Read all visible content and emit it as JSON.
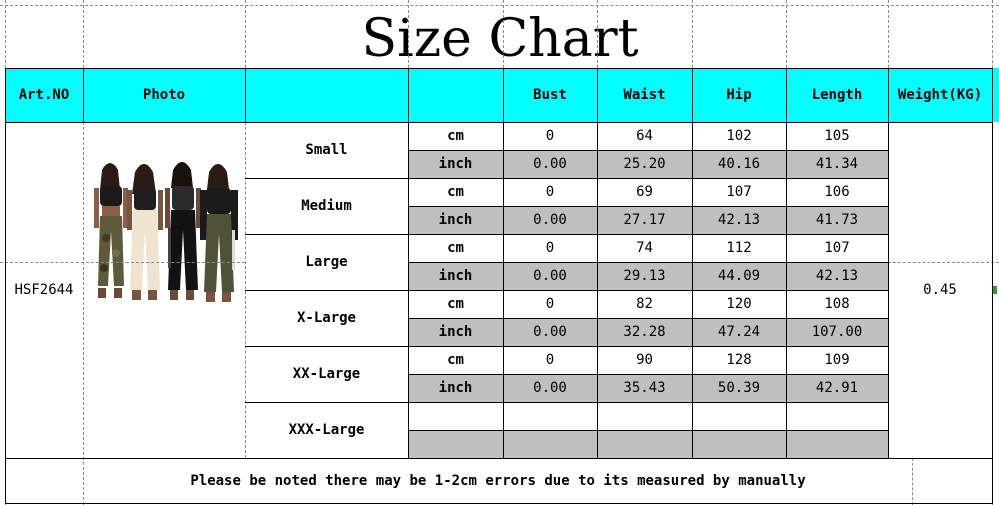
{
  "title": "Size Chart",
  "header": {
    "art_no": "Art.NO",
    "photo": "Photo",
    "bust": "Bust",
    "waist": "Waist",
    "hip": "Hip",
    "length": "Length",
    "weight": "Weight(KG)"
  },
  "art_no_value": "HSF2644",
  "weight_value": "0.45",
  "sizes": [
    {
      "name": "Small",
      "cm": {
        "unit": "cm",
        "bust": "0",
        "waist": "64",
        "hip": "102",
        "length": "105"
      },
      "inch": {
        "unit": "inch",
        "bust": "0.00",
        "waist": "25.20",
        "hip": "40.16",
        "length": "41.34"
      }
    },
    {
      "name": "Medium",
      "cm": {
        "unit": "cm",
        "bust": "0",
        "waist": "69",
        "hip": "107",
        "length": "106"
      },
      "inch": {
        "unit": "inch",
        "bust": "0.00",
        "waist": "27.17",
        "hip": "42.13",
        "length": "41.73"
      }
    },
    {
      "name": "Large",
      "cm": {
        "unit": "cm",
        "bust": "0",
        "waist": "74",
        "hip": "112",
        "length": "107"
      },
      "inch": {
        "unit": "inch",
        "bust": "0.00",
        "waist": "29.13",
        "hip": "44.09",
        "length": "42.13"
      }
    },
    {
      "name": "X-Large",
      "cm": {
        "unit": "cm",
        "bust": "0",
        "waist": "82",
        "hip": "120",
        "length": "108"
      },
      "inch": {
        "unit": "inch",
        "bust": "0.00",
        "waist": "32.28",
        "hip": "47.24",
        "length": "107.00"
      }
    },
    {
      "name": "XX-Large",
      "cm": {
        "unit": "cm",
        "bust": "0",
        "waist": "90",
        "hip": "128",
        "length": "109"
      },
      "inch": {
        "unit": "inch",
        "bust": "0.00",
        "waist": "35.43",
        "hip": "50.39",
        "length": "42.91"
      }
    },
    {
      "name": "XXX-Large",
      "cm": {
        "unit": "",
        "bust": "",
        "waist": "",
        "hip": "",
        "length": ""
      },
      "inch": {
        "unit": "",
        "bust": "",
        "waist": "",
        "hip": "",
        "length": ""
      }
    }
  ],
  "footnote": "Please be noted there may be 1-2cm errors due to its measured by manually",
  "colors": {
    "header_bg": "#00ffff",
    "inch_row_bg": "#bfbfbf"
  },
  "photo_icon": "models-photo"
}
